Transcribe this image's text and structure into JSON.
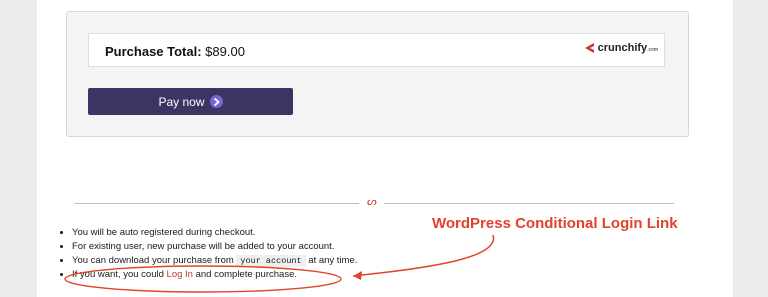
{
  "purchase": {
    "total_label": "Purchase Total:",
    "total_value": " $89.00",
    "logo_text": "crunchify",
    "logo_suffix": ".com",
    "pay_label": "Pay now"
  },
  "notes": {
    "item1": "You will be auto registered during checkout.",
    "item2": "For existing user, new purchase will be added to your account.",
    "item3_before": "You can download your purchase from ",
    "item3_code": "your account",
    "item3_after": " at any time.",
    "item4_before": "If you want, you could ",
    "item4_link": "Log In",
    "item4_after": " and complete purchase."
  },
  "annotation": {
    "text": "WordPress Conditional Login Link",
    "color": "#e2432a"
  },
  "colors": {
    "pay_button": "#3a3562",
    "accent": "#c5392f"
  }
}
